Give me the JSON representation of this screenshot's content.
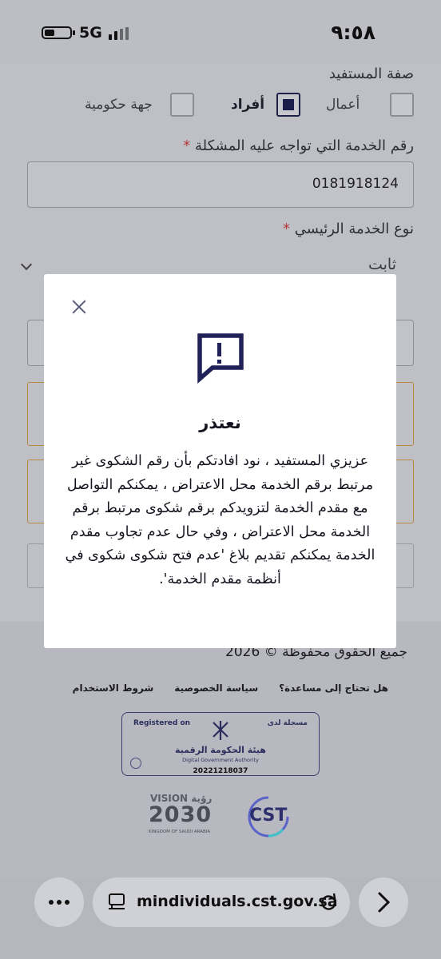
{
  "status_bar": {
    "time": "٩:٥٨",
    "network": "5G"
  },
  "form": {
    "beneficiary_label": "صفة المستفيد",
    "options": [
      {
        "label": "أعمال",
        "checked": false
      },
      {
        "label": "أفراد",
        "checked": true
      },
      {
        "label": "جهة حكومية",
        "checked": false
      }
    ],
    "service_number_label": "رقم الخدمة التي تواجه عليه المشكلة",
    "service_number_value": "0181918124",
    "main_service_label": "نوع الخدمة الرئيسي",
    "main_service_value": "ثابت",
    "required_mark": "*"
  },
  "modal": {
    "title": "نعتذر",
    "body": "عزيزي المستفيد ، نود افادتكم بأن رقم الشكوى غير مرتبط برقم الخدمة محل الاعتراض ، يمكنكم التواصل مع مقدم الخدمة لتزويدكم برقم شكوى مرتبط برقم الخدمة محل الاعتراض ، وفي حال عدم تجاوب مقدم الخدمة يمكنكم تقديم بلاغ 'عدم فتح شكوى شكوى في أنظمة مقدم الخدمة'."
  },
  "footer": {
    "copyright": "جميع الحقوق محفوظة © 2026",
    "links": [
      "هل تحتاج إلى مساعدة؟",
      "سياسة الخصوصية",
      "شروط الاستخدام"
    ],
    "dga": {
      "registered_on_en": "Registered on",
      "registered_on_ar": "مسجلة لدى",
      "name_ar": "هيئة الحكومة الرقمية",
      "name_en": "Digital Government Authority",
      "number": "20221218037"
    },
    "vision": {
      "top": "VISION رؤية",
      "year": "2030",
      "bottom": "KINGDOM OF SAUDI ARABIA"
    },
    "cst_logo": "CST"
  },
  "browser": {
    "url": "mindividuals.cst.gov.sa"
  },
  "icons": {
    "more": "more-icon",
    "tabs": "tabs-icon",
    "reload": "reload-icon",
    "forward": "forward-icon",
    "close": "close-icon",
    "alert": "chat-alert-icon"
  }
}
